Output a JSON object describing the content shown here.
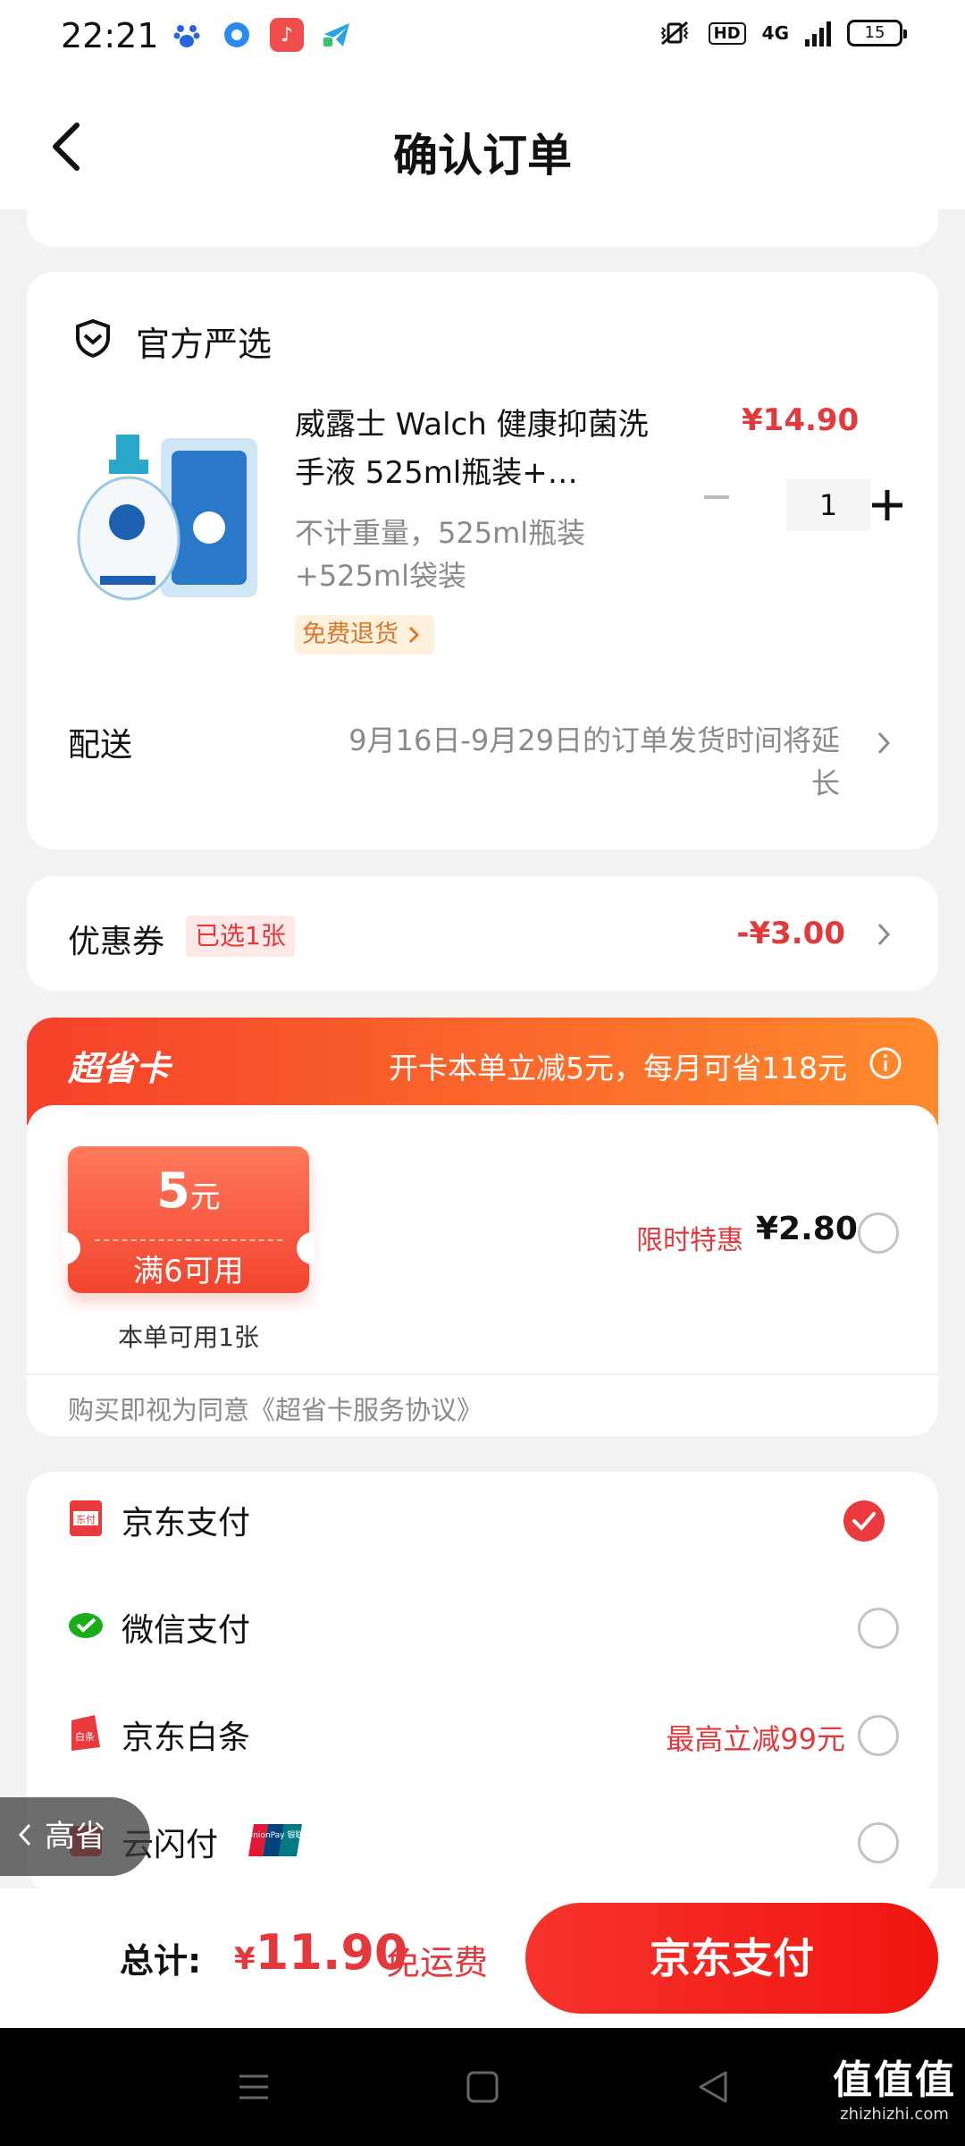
{
  "status_bar": {
    "time": "22:21",
    "network": "4G",
    "hd_label": "HD",
    "battery": "15",
    "app_icons": [
      "baidu-icon",
      "qq-browser-icon",
      "music-icon",
      "telegram-icon"
    ]
  },
  "header": {
    "title": "确认订单",
    "back_icon": "back-arrow-icon"
  },
  "order": {
    "shop_name": "官方严选",
    "product": {
      "title": "威露士 Walch 健康抑菌洗手液 525ml瓶装+…",
      "price": "¥14.90",
      "quantity": "1",
      "spec": "不计重量，525ml瓶装+525ml袋装",
      "return_tag": "免费退货"
    },
    "delivery": {
      "label": "配送",
      "text": "9月16日-9月29日的订单发货时间将延长"
    }
  },
  "coupon": {
    "label": "优惠券",
    "selected": "已选1张",
    "amount": "-¥3.00"
  },
  "super_card": {
    "title": "超省卡",
    "promo": "开卡本单立减5元，每月可省118元",
    "voucher_amount": "5",
    "voucher_unit": "元",
    "voucher_condition": "满6可用",
    "voucher_availability": "本单可用1张",
    "limited_label": "限时特惠",
    "price": "¥2.80",
    "agreement": "购买即视为同意《超省卡服务协议》"
  },
  "payment": {
    "methods": [
      {
        "label": "京东支付",
        "icon": "jd-pay-icon",
        "promo": "",
        "selected": true
      },
      {
        "label": "微信支付",
        "icon": "wechat-pay-icon",
        "promo": "",
        "selected": false
      },
      {
        "label": "京东白条",
        "icon": "jd-baitiao-icon",
        "promo": "最高立减99元",
        "selected": false
      },
      {
        "label": "云闪付",
        "icon": "cloud-quickpass-icon",
        "promo": "",
        "selected": false
      }
    ],
    "unionpay_badge": "UnionPay 银联"
  },
  "side_pill": {
    "label": "高省"
  },
  "bottom_bar": {
    "total_label": "总计:",
    "currency": "¥",
    "total_amount": "11.90",
    "shipping": "免运费",
    "pay_button": "京东支付"
  },
  "watermark": {
    "big": "值值值",
    "small": "zhizhizhi.com"
  },
  "colors": {
    "accent_red": "#e4393c",
    "orange_start": "#f5412a",
    "orange_end": "#ff8a2d"
  }
}
